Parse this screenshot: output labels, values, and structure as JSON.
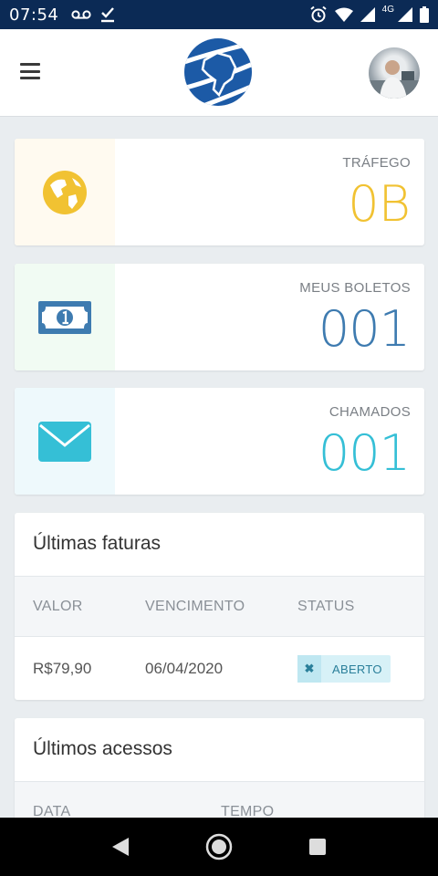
{
  "status_bar": {
    "time": "07:54",
    "network": "4G"
  },
  "header": {
    "menu_icon": "hamburger-icon",
    "logo": "brazil-globe-logo",
    "avatar": "user-avatar"
  },
  "stats": [
    {
      "label": "TRÁFEGO",
      "value": "0B",
      "icon": "globe-icon",
      "color": "#f1c232",
      "bg": "#fffaf0"
    },
    {
      "label": "MEUS BOLETOS",
      "value": "001",
      "icon": "banknote-icon",
      "color": "#3e7bb0",
      "bg": "#f1fbf3"
    },
    {
      "label": "CHAMADOS",
      "value": "001",
      "icon": "envelope-icon",
      "color": "#35bfd6",
      "bg": "#eef9fc"
    }
  ],
  "invoices": {
    "title": "Últimas faturas",
    "columns": [
      "VALOR",
      "VENCIMENTO",
      "STATUS"
    ],
    "rows": [
      {
        "valor": "R$79,90",
        "vencimento": "06/04/2020",
        "status": "ABERTO"
      }
    ]
  },
  "accesses": {
    "title": "Últimos acessos",
    "columns": [
      "DATA",
      "TEMPO"
    ]
  },
  "nav": {
    "back": "back-icon",
    "home": "home-icon",
    "recents": "recents-icon"
  }
}
